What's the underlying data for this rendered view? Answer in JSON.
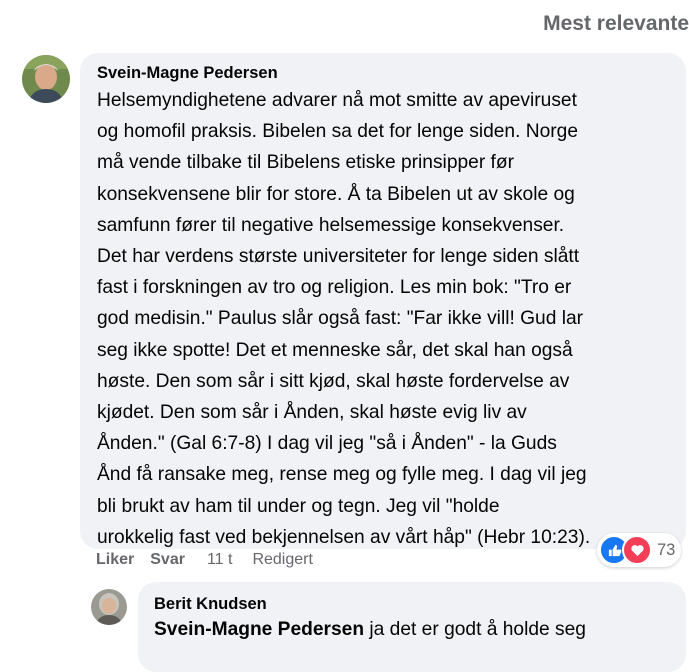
{
  "sort_label": "Mest relevante",
  "comment": {
    "author": "Svein-Magne Pedersen",
    "lines": [
      "Helsemyndighetene advarer nå mot smitte av apeviruset",
      "og homofil praksis. Bibelen sa det for lenge siden. Norge",
      "må vende tilbake til Bibelens etiske prinsipper før",
      "konsekvensene blir for store. Å ta Bibelen ut av skole og",
      "samfunn fører til negative helsemessige konsekvenser.",
      "Det har verdens største universiteter for lenge siden slått",
      "fast i forskningen av tro og religion. Les min bok: \"Tro er",
      "god medisin.\" Paulus slår også fast: \"Far ikke vill! Gud lar",
      "seg ikke spotte! Det et menneske sår, det skal han også",
      "høste. Den som sår i sitt kjød, skal høste fordervelse av",
      "kjødet. Den som sår i Ånden, skal høste evig liv av",
      "Ånden.\" (Gal 6:7-8) I dag vil jeg \"så i Ånden\" - la Guds",
      "Ånd få ransake meg, rense meg og fylle meg. I dag vil jeg",
      "bli brukt av ham til under og tegn. Jeg vil \"holde",
      "urokkelig fast ved bekjennelsen av vårt håp\" (Hebr 10:23)."
    ],
    "actions": {
      "like": "Liker",
      "reply": "Svar",
      "time": "11 t",
      "edited": "Redigert"
    },
    "reactions": {
      "count": "73",
      "types": [
        "like-icon",
        "love-icon"
      ],
      "like_color": "#1877f2",
      "love_color": "#f33e58"
    }
  },
  "reply": {
    "author": "Berit Knudsen",
    "mention": "Svein-Magne Pedersen",
    "text": " ja det er godt å holde seg"
  }
}
